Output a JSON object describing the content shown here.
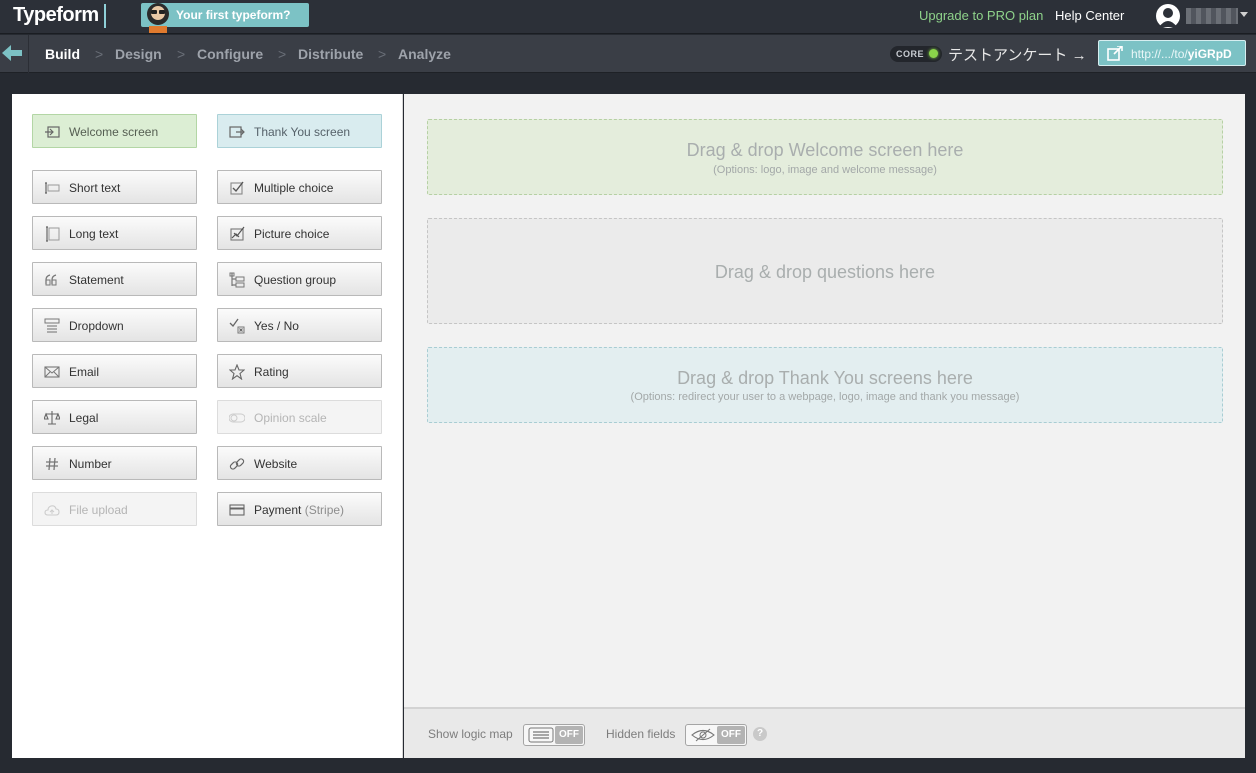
{
  "header": {
    "logo": "Typeform",
    "first_typeform": "Your first typeform?",
    "upgrade": "Upgrade to PRO plan",
    "help_center": "Help Center",
    "colors": {
      "accent": "#7cc2c5",
      "upgrade": "#8ed28a",
      "bar": "#2c3038"
    }
  },
  "nav": {
    "steps": [
      "Build",
      "Design",
      "Configure",
      "Distribute",
      "Analyze"
    ],
    "active": "Build",
    "separator": ">",
    "core_badge": "CORE",
    "form_title": "テストアンケート →",
    "share_url_prefix": "http://.../to/",
    "share_url_id": "yiGRpD"
  },
  "question_types": {
    "welcome": "Welcome screen",
    "thank_you": "Thank You screen",
    "short_text": "Short text",
    "multiple_choice": "Multiple choice",
    "long_text": "Long text",
    "picture_choice": "Picture choice",
    "statement": "Statement",
    "question_group": "Question group",
    "dropdown": "Dropdown",
    "yes_no": "Yes / No",
    "email": "Email",
    "rating": "Rating",
    "legal": "Legal",
    "opinion_scale": "Opinion scale",
    "number": "Number",
    "website": "Website",
    "file_upload": "File upload",
    "payment": "Payment",
    "payment_note": "(Stripe)"
  },
  "dropzones": {
    "welcome_title": "Drag & drop Welcome screen here",
    "welcome_sub": "(Options: logo, image and welcome message)",
    "questions_title": "Drag & drop questions here",
    "thanks_title": "Drag & drop Thank You screens here",
    "thanks_sub": "(Options: redirect your user to a webpage, logo, image and thank you message)"
  },
  "bottom": {
    "logic_map_label": "Show logic map",
    "logic_map_state": "OFF",
    "hidden_fields_label": "Hidden fields",
    "hidden_fields_state": "OFF",
    "help": "?"
  }
}
